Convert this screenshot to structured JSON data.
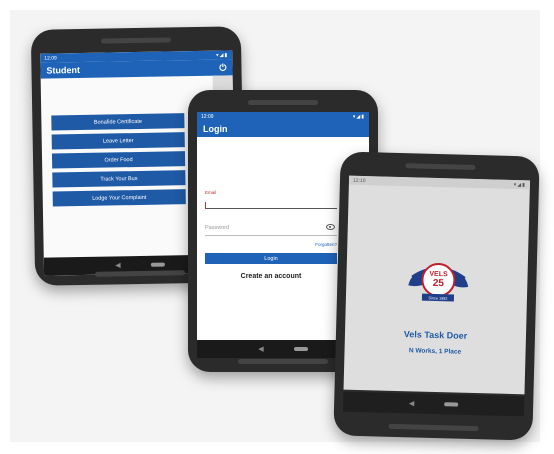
{
  "student_screen": {
    "status_time": "12:09",
    "title": "Student",
    "menu": [
      "Bonafide Certificate",
      "Leave Letter",
      "Order Food",
      "Track Your Bus",
      "Lodge Your Complaint"
    ]
  },
  "login_screen": {
    "status_time": "12:09",
    "title": "Login",
    "email_label": "Email",
    "password_placeholder": "Password",
    "forgot_label": "Forgotten?",
    "login_button": "Login",
    "create_account": "Create an account"
  },
  "splash_screen": {
    "status_time": "12:10",
    "logo_text": "VELS",
    "logo_number": "25",
    "logo_since": "Since 1992",
    "title": "Vels Task Doer",
    "subtitle": "N Works, 1 Place"
  },
  "colors": {
    "primary": "#1e63b8",
    "button": "#1f5aa6",
    "logo_red": "#c0202a",
    "logo_gold": "#c8a040"
  },
  "icons": {
    "power": "power-icon",
    "eye": "eye-icon"
  }
}
